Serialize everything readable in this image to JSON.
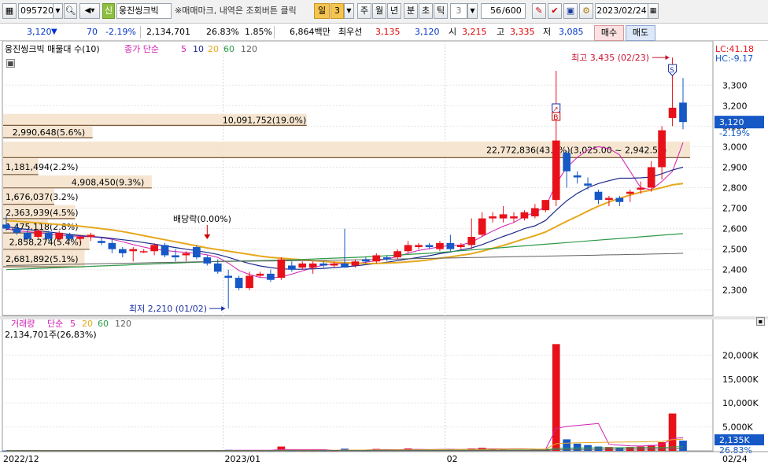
{
  "toolbar": {
    "code": "095720",
    "name_badge": "신",
    "name": "웅진씽크빅",
    "notice": "※매매마크, 내역은 조회버튼 클릭",
    "period_sel": "일",
    "period_num": "3",
    "periods": [
      "주",
      "월",
      "년",
      "분",
      "초",
      "틱"
    ],
    "tick_num": "3",
    "count": "56",
    "count_total": "/600",
    "date": "2023/02/24"
  },
  "quote": {
    "price": "3,120",
    "arrow": "▼",
    "change": "70",
    "change_pct": "-2.19%",
    "volume": "2,134,701",
    "turnover_pct": "26.83%",
    "pct2": "1.85%",
    "amount": "6,864백만",
    "best_label": "최우선",
    "best_ask": "3,135",
    "best_bid": "3,120",
    "open_label": "시",
    "open": "3,215",
    "high_label": "고",
    "high": "3,335",
    "low_label": "저",
    "low": "3,085",
    "buy_label": "매수",
    "sell_label": "매도"
  },
  "price_panel": {
    "legend_stock": "웅진씽크빅 매물대 수(10)",
    "legend_ma": "종가 단순",
    "ma_periods": [
      "5",
      "10",
      "20",
      "60",
      "120"
    ],
    "lc_label": "LC:41.18",
    "hc_label": "HC:-9.17",
    "current_price": "3,120",
    "current_change": "-2.19%",
    "y_ticks": [
      "3,300",
      "3,200",
      "3,100",
      "3,000",
      "2,900",
      "2,800",
      "2,700",
      "2,600",
      "2,500",
      "2,400",
      "2,300"
    ],
    "high_annot": "최고 3,435 (02/23)",
    "low_annot": "최저 2,210 (01/02)",
    "dividend_annot": "배당락(0.00%)",
    "markers": {
      "sell": "S",
      "buy": "B"
    }
  },
  "volume_profile": [
    {
      "label": "10,091,752(19.0%)",
      "lo": 3100,
      "hi": 3160,
      "pct": 19.0
    },
    {
      "label": "2,990,648(5.6%)",
      "lo": 3040,
      "hi": 3100,
      "pct": 5.6
    },
    {
      "label": "22,772,836(43.0%)(3,025.00 ~ 2,942.50)",
      "lo": 2942.5,
      "hi": 3025,
      "pct": 43.0
    },
    {
      "label": "1,181,494(2.2%)",
      "lo": 2860,
      "hi": 2942.5,
      "pct": 2.2
    },
    {
      "label": "4,908,450(9.3%)",
      "lo": 2795,
      "hi": 2860,
      "pct": 9.3
    },
    {
      "label": "1,676,037(3.2%)",
      "lo": 2715,
      "hi": 2795,
      "pct": 3.2
    },
    {
      "label": "2,363,939(4.5%)",
      "lo": 2645,
      "hi": 2715,
      "pct": 4.5
    },
    {
      "label": "1,475,118(2.8%)",
      "lo": 2575,
      "hi": 2645,
      "pct": 2.8
    },
    {
      "label": "2,858,274(5.4%)",
      "lo": 2495,
      "hi": 2575,
      "pct": 5.4
    },
    {
      "label": "2,681,892(5.1%)",
      "lo": 2410,
      "hi": 2495,
      "pct": 5.1
    }
  ],
  "volume_panel": {
    "legend": "거래량",
    "legend_ma": "단순",
    "ma_periods": [
      "5",
      "20",
      "60",
      "120"
    ],
    "current_label": "2,134,701주(26,83%)",
    "y_ticks": [
      "20,000K",
      "15,000K",
      "10,000K",
      "5,000K"
    ],
    "current_value": "2,135K",
    "current_pct": "26.83%"
  },
  "x_labels": [
    "2022/12",
    "2023/01",
    "02",
    "02/24"
  ],
  "colors": {
    "up": "#e8111a",
    "down": "#1558c6",
    "ma5": "#d21fb3",
    "ma10": "#1c2b8c",
    "ma20": "#e6a81e",
    "ma60": "#2e9a47",
    "ma120": "#606060",
    "profile": "#f5e3cc"
  },
  "chart_data": {
    "type": "candlestick",
    "ylim": [
      2180,
      3470
    ],
    "volume_ylim": [
      0,
      24000
    ],
    "candles": [
      {
        "o": 2620,
        "h": 2660,
        "l": 2590,
        "c": 2600
      },
      {
        "o": 2600,
        "h": 2620,
        "l": 2570,
        "c": 2580
      },
      {
        "o": 2580,
        "h": 2600,
        "l": 2540,
        "c": 2550
      },
      {
        "o": 2560,
        "h": 2600,
        "l": 2550,
        "c": 2590
      },
      {
        "o": 2580,
        "h": 2590,
        "l": 2540,
        "c": 2550
      },
      {
        "o": 2550,
        "h": 2590,
        "l": 2540,
        "c": 2580
      },
      {
        "o": 2570,
        "h": 2580,
        "l": 2540,
        "c": 2550
      },
      {
        "o": 2550,
        "h": 2570,
        "l": 2530,
        "c": 2560
      },
      {
        "o": 2560,
        "h": 2580,
        "l": 2540,
        "c": 2570
      },
      {
        "o": 2540,
        "h": 2560,
        "l": 2520,
        "c": 2530
      },
      {
        "o": 2530,
        "h": 2550,
        "l": 2480,
        "c": 2500
      },
      {
        "o": 2500,
        "h": 2510,
        "l": 2460,
        "c": 2480
      },
      {
        "o": 2490,
        "h": 2510,
        "l": 2440,
        "c": 2500
      },
      {
        "o": 2490,
        "h": 2500,
        "l": 2480,
        "c": 2490
      },
      {
        "o": 2490,
        "h": 2530,
        "l": 2470,
        "c": 2520
      },
      {
        "o": 2520,
        "h": 2530,
        "l": 2460,
        "c": 2470
      },
      {
        "o": 2470,
        "h": 2500,
        "l": 2440,
        "c": 2460
      },
      {
        "o": 2470,
        "h": 2490,
        "l": 2440,
        "c": 2480
      },
      {
        "o": 2510,
        "h": 2520,
        "l": 2450,
        "c": 2460
      },
      {
        "o": 2460,
        "h": 2470,
        "l": 2420,
        "c": 2430
      },
      {
        "o": 2430,
        "h": 2450,
        "l": 2380,
        "c": 2390
      },
      {
        "o": 2370,
        "h": 2400,
        "l": 2210,
        "c": 2360
      },
      {
        "o": 2360,
        "h": 2370,
        "l": 2300,
        "c": 2310
      },
      {
        "o": 2310,
        "h": 2390,
        "l": 2300,
        "c": 2370
      },
      {
        "o": 2370,
        "h": 2390,
        "l": 2360,
        "c": 2380
      },
      {
        "o": 2380,
        "h": 2400,
        "l": 2340,
        "c": 2350
      },
      {
        "o": 2360,
        "h": 2460,
        "l": 2350,
        "c": 2450
      },
      {
        "o": 2420,
        "h": 2440,
        "l": 2390,
        "c": 2400
      },
      {
        "o": 2410,
        "h": 2440,
        "l": 2400,
        "c": 2430
      },
      {
        "o": 2410,
        "h": 2440,
        "l": 2380,
        "c": 2430
      },
      {
        "o": 2430,
        "h": 2440,
        "l": 2410,
        "c": 2420
      },
      {
        "o": 2420,
        "h": 2440,
        "l": 2410,
        "c": 2430
      },
      {
        "o": 2430,
        "h": 2600,
        "l": 2410,
        "c": 2410
      },
      {
        "o": 2420,
        "h": 2450,
        "l": 2410,
        "c": 2440
      },
      {
        "o": 2450,
        "h": 2460,
        "l": 2430,
        "c": 2440
      },
      {
        "o": 2440,
        "h": 2480,
        "l": 2430,
        "c": 2470
      },
      {
        "o": 2460,
        "h": 2470,
        "l": 2440,
        "c": 2450
      },
      {
        "o": 2460,
        "h": 2500,
        "l": 2450,
        "c": 2490
      },
      {
        "o": 2490,
        "h": 2540,
        "l": 2480,
        "c": 2520
      },
      {
        "o": 2510,
        "h": 2530,
        "l": 2500,
        "c": 2520
      },
      {
        "o": 2520,
        "h": 2530,
        "l": 2500,
        "c": 2510
      },
      {
        "o": 2500,
        "h": 2540,
        "l": 2490,
        "c": 2530
      },
      {
        "o": 2530,
        "h": 2570,
        "l": 2490,
        "c": 2500
      },
      {
        "o": 2510,
        "h": 2530,
        "l": 2500,
        "c": 2520
      },
      {
        "o": 2520,
        "h": 2650,
        "l": 2500,
        "c": 2560
      },
      {
        "o": 2570,
        "h": 2680,
        "l": 2560,
        "c": 2650
      },
      {
        "o": 2650,
        "h": 2680,
        "l": 2630,
        "c": 2660
      },
      {
        "o": 2650,
        "h": 2710,
        "l": 2630,
        "c": 2670
      },
      {
        "o": 2650,
        "h": 2680,
        "l": 2630,
        "c": 2660
      },
      {
        "o": 2650,
        "h": 2690,
        "l": 2640,
        "c": 2680
      },
      {
        "o": 2660,
        "h": 2720,
        "l": 2650,
        "c": 2700
      },
      {
        "o": 2690,
        "h": 2740,
        "l": 2680,
        "c": 2740
      },
      {
        "o": 2740,
        "h": 3370,
        "l": 2710,
        "c": 3030
      },
      {
        "o": 2970,
        "h": 2980,
        "l": 2800,
        "c": 2880
      },
      {
        "o": 2860,
        "h": 2880,
        "l": 2820,
        "c": 2850
      },
      {
        "o": 2820,
        "h": 2850,
        "l": 2790,
        "c": 2810
      },
      {
        "o": 2780,
        "h": 2790,
        "l": 2720,
        "c": 2740
      },
      {
        "o": 2740,
        "h": 2760,
        "l": 2710,
        "c": 2750
      },
      {
        "o": 2750,
        "h": 2760,
        "l": 2710,
        "c": 2730
      },
      {
        "o": 2770,
        "h": 2790,
        "l": 2730,
        "c": 2780
      },
      {
        "o": 2790,
        "h": 2830,
        "l": 2770,
        "c": 2800
      },
      {
        "o": 2800,
        "h": 2930,
        "l": 2780,
        "c": 2900
      },
      {
        "o": 2900,
        "h": 3100,
        "l": 2840,
        "c": 3080
      },
      {
        "o": 3140,
        "h": 3435,
        "l": 3100,
        "c": 3190
      },
      {
        "o": 3215,
        "h": 3335,
        "l": 3085,
        "c": 3120
      }
    ],
    "volume": [
      60,
      50,
      40,
      50,
      40,
      40,
      40,
      40,
      40,
      40,
      60,
      50,
      40,
      40,
      60,
      40,
      40,
      40,
      50,
      50,
      120,
      200,
      140,
      100,
      90,
      70,
      900,
      80,
      100,
      90,
      70,
      60,
      450,
      150,
      130,
      400,
      200,
      250,
      500,
      200,
      180,
      350,
      400,
      150,
      500,
      650,
      400,
      300,
      250,
      250,
      300,
      400,
      22300,
      2400,
      1500,
      1200,
      900,
      800,
      700,
      800,
      900,
      1200,
      1800,
      7800,
      2135
    ],
    "ma": {
      "ma5": [
        2600,
        2590,
        2585,
        2580,
        2575,
        2568,
        2565,
        2562,
        2560,
        2556,
        2548,
        2536,
        2522,
        2510,
        2500,
        2494,
        2488,
        2484,
        2480,
        2472,
        2460,
        2432,
        2396,
        2376,
        2362,
        2360,
        2364,
        2378,
        2394,
        2410,
        2422,
        2428,
        2430,
        2430,
        2436,
        2444,
        2452,
        2464,
        2480,
        2494,
        2502,
        2512,
        2518,
        2520,
        2534,
        2562,
        2588,
        2612,
        2630,
        2660,
        2680,
        2706,
        2820,
        2898,
        2948,
        2984,
        3000,
        2990,
        2960,
        2880,
        2800,
        2790,
        2830,
        2880,
        3020
      ],
      "ma10": [
        2610,
        2602,
        2596,
        2590,
        2584,
        2578,
        2572,
        2566,
        2562,
        2558,
        2552,
        2546,
        2540,
        2532,
        2524,
        2516,
        2508,
        2500,
        2492,
        2484,
        2474,
        2460,
        2444,
        2430,
        2418,
        2410,
        2404,
        2402,
        2402,
        2404,
        2406,
        2410,
        2414,
        2418,
        2424,
        2430,
        2436,
        2444,
        2452,
        2460,
        2468,
        2478,
        2486,
        2496,
        2506,
        2522,
        2542,
        2562,
        2580,
        2600,
        2614,
        2640,
        2690,
        2736,
        2772,
        2800,
        2820,
        2834,
        2846,
        2846,
        2848,
        2852,
        2868,
        2886,
        2900
      ],
      "ma20": [
        2640,
        2636,
        2632,
        2628,
        2624,
        2620,
        2616,
        2612,
        2606,
        2600,
        2594,
        2586,
        2576,
        2566,
        2556,
        2546,
        2536,
        2526,
        2516,
        2506,
        2498,
        2490,
        2482,
        2474,
        2466,
        2460,
        2456,
        2452,
        2448,
        2444,
        2440,
        2436,
        2434,
        2432,
        2430,
        2430,
        2432,
        2434,
        2438,
        2442,
        2448,
        2456,
        2462,
        2470,
        2478,
        2490,
        2504,
        2518,
        2534,
        2550,
        2566,
        2584,
        2610,
        2636,
        2660,
        2686,
        2710,
        2730,
        2748,
        2764,
        2778,
        2788,
        2800,
        2814,
        2820
      ],
      "ma60": [
        2400,
        2402,
        2404,
        2406,
        2408,
        2410,
        2412,
        2414,
        2416,
        2418,
        2420,
        2422,
        2424,
        2426,
        2428,
        2430,
        2432,
        2434,
        2436,
        2438,
        2440,
        2441,
        2442,
        2443,
        2444,
        2445,
        2446,
        2448,
        2450,
        2452,
        2454,
        2456,
        2458,
        2460,
        2462,
        2465,
        2468,
        2471,
        2474,
        2477,
        2480,
        2484,
        2488,
        2492,
        2496,
        2500,
        2504,
        2508,
        2512,
        2516,
        2520,
        2524,
        2528,
        2532,
        2536,
        2540,
        2544,
        2548,
        2552,
        2556,
        2560,
        2564,
        2568,
        2572,
        2576
      ],
      "ma120": [
        2420,
        2421,
        2422,
        2423,
        2424,
        2425,
        2426,
        2427,
        2428,
        2429,
        2430,
        2431,
        2432,
        2433,
        2434,
        2435,
        2436,
        2437,
        2438,
        2439,
        2440,
        2440,
        2441,
        2441,
        2442,
        2442,
        2443,
        2443,
        2444,
        2444,
        2445,
        2446,
        2447,
        2448,
        2449,
        2450,
        2451,
        2452,
        2453,
        2454,
        2455,
        2456,
        2457,
        2458,
        2459,
        2460,
        2461,
        2462,
        2463,
        2464,
        2465,
        2466,
        2467,
        2468,
        2469,
        2470,
        2471,
        2472,
        2473,
        2474,
        2475,
        2476,
        2477,
        2478,
        2480
      ]
    },
    "volume_ma": {
      "ma5": [
        50,
        48,
        46,
        46,
        44,
        42,
        42,
        42,
        40,
        40,
        44,
        46,
        46,
        48,
        50,
        48,
        44,
        44,
        44,
        44,
        60,
        92,
        112,
        122,
        130,
        124,
        280,
        268,
        268,
        266,
        266,
        80,
        160,
        172,
        174,
        246,
        266,
        226,
        300,
        320,
        266,
        296,
        326,
        276,
        356,
        410,
        420,
        400,
        420,
        430,
        340,
        300,
        4700,
        5100,
        5300,
        5500,
        5700,
        1360,
        1180,
        1060,
        1000,
        1100,
        1240,
        2600,
        2730
      ],
      "ma20": [
        50,
        50,
        50,
        50,
        50,
        50,
        50,
        50,
        50,
        50,
        50,
        50,
        50,
        50,
        50,
        50,
        50,
        50,
        50,
        50,
        55,
        62,
        68,
        72,
        76,
        78,
        120,
        122,
        126,
        130,
        134,
        134,
        156,
        160,
        164,
        180,
        188,
        198,
        220,
        228,
        236,
        250,
        268,
        274,
        294,
        324,
        340,
        350,
        360,
        370,
        376,
        386,
        1490,
        1606,
        1676,
        1732,
        1766,
        1800,
        1826,
        1850,
        1880,
        1922,
        1980,
        2340,
        2416
      ],
      "ma60": [
        40,
        40,
        40,
        40,
        40,
        40,
        40,
        40,
        40,
        40,
        40,
        40,
        40,
        40,
        40,
        40,
        40,
        40,
        40,
        40,
        42,
        44,
        46,
        48,
        50,
        52,
        66,
        68,
        70,
        72,
        74,
        76,
        82,
        84,
        86,
        92,
        96,
        100,
        108,
        112,
        116,
        120,
        126,
        130,
        136,
        146,
        152,
        156,
        160,
        164,
        168,
        172,
        540,
        580,
        600,
        620,
        640,
        650,
        660,
        670,
        680,
        690,
        700,
        820,
        850
      ],
      "ma120": [
        30,
        30,
        30,
        30,
        30,
        30,
        30,
        30,
        30,
        30,
        30,
        30,
        30,
        30,
        30,
        30,
        30,
        30,
        30,
        30,
        31,
        32,
        33,
        34,
        35,
        36,
        40,
        41,
        42,
        43,
        44,
        45,
        48,
        49,
        50,
        52,
        54,
        56,
        58,
        60,
        62,
        64,
        66,
        68,
        70,
        74,
        76,
        78,
        80,
        82,
        84,
        86,
        270,
        290,
        300,
        310,
        320,
        326,
        332,
        338,
        344,
        350,
        356,
        416,
        430
      ]
    }
  }
}
